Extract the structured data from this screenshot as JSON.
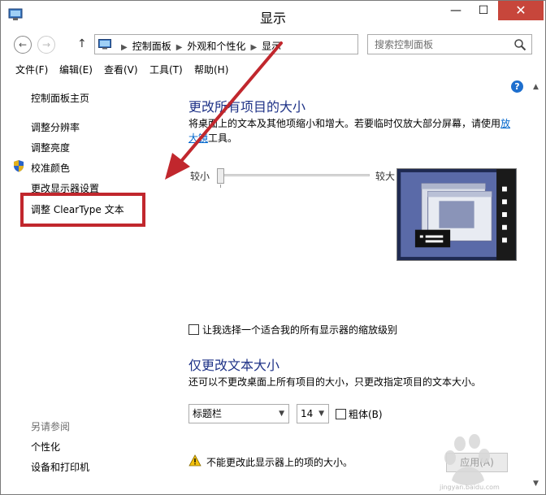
{
  "window": {
    "title": "显示",
    "controls": {
      "minimize": "—",
      "maximize": "☐",
      "close": "✕"
    }
  },
  "address": {
    "crumbs": [
      "控制面板",
      "外观和个性化",
      "显示"
    ],
    "search_placeholder": "搜索控制面板"
  },
  "menu": [
    "文件(F)",
    "编辑(E)",
    "查看(V)",
    "工具(T)",
    "帮助(H)"
  ],
  "sidebar": {
    "home": "控制面板主页",
    "links": [
      "调整分辨率",
      "调整亮度",
      "校准颜色",
      "更改显示器设置",
      "调整 ClearType 文本"
    ],
    "see_also_title": "另请参阅",
    "see_also": [
      "个性化",
      "设备和打印机"
    ]
  },
  "main": {
    "section1_title": "更改所有项目的大小",
    "section1_desc": "将桌面上的文本及其他项缩小和增大。若要临时仅放大部分屏幕，请使用",
    "section1_link": "放大镜",
    "section1_desc_end": "工具。",
    "slider_min_label": "较小",
    "slider_max_label": "较大",
    "slider_value": 0,
    "checkbox_scale_label": "让我选择一个适合我的所有显示器的缩放级别",
    "checkbox_scale_checked": false,
    "section2_title": "仅更改文本大小",
    "section2_desc": "还可以不更改桌面上所有项目的大小，只更改指定项目的文本大小。",
    "item_select_value": "标题栏",
    "size_select_value": "14",
    "bold_label": "粗体(B)",
    "bold_checked": false,
    "warning_text": "不能更改此显示器上的项的大小。",
    "apply_label": "应用(A)"
  },
  "watermark": {
    "text": "jingyan.baidu.com"
  },
  "colors": {
    "heading": "#1e3287",
    "link": "#0066cc",
    "close": "#c7463b",
    "annotation": "#c1272d"
  }
}
